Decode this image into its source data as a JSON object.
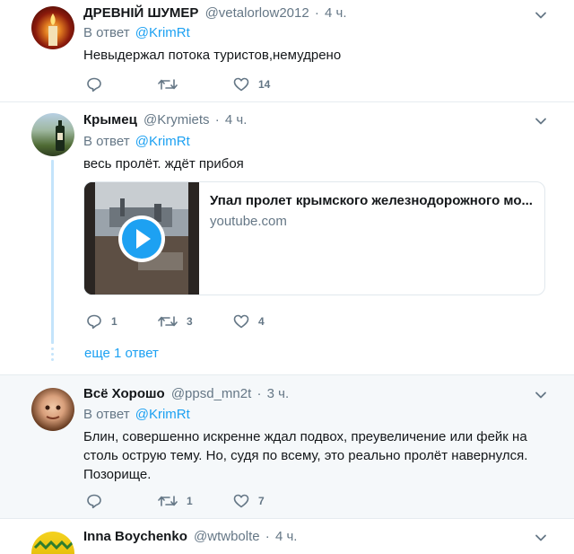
{
  "colors": {
    "accent": "#1da1f2",
    "muted": "#657786",
    "text": "#14171a",
    "border": "#e6ecf0",
    "highlight_bg": "#f5f8fa"
  },
  "tweets": [
    {
      "name": "ДРЕВНІЙ ШУМЕР",
      "handle": "@vetalorlow2012",
      "separator": "·",
      "time": "4 ч.",
      "reply_prefix": "В ответ",
      "reply_mention": "@KrimRt",
      "text": "Невыдержал потока туристов,немудрено",
      "reply_count": "",
      "retweet_count": "",
      "like_count": "14"
    },
    {
      "name": "Крымец",
      "handle": "@Krymiets",
      "separator": "·",
      "time": "4 ч.",
      "reply_prefix": "В ответ",
      "reply_mention": "@KrimRt",
      "text": "весь пролёт. ждёт прибоя",
      "card": {
        "title": "Упал пролет крымского железнодорожного мо...",
        "domain": "youtube.com"
      },
      "reply_count": "1",
      "retweet_count": "3",
      "like_count": "4",
      "more_replies": "еще 1 ответ"
    },
    {
      "name": "Всё Хорошо",
      "handle": "@ppsd_mn2t",
      "separator": "·",
      "time": "3 ч.",
      "reply_prefix": "В ответ",
      "reply_mention": "@KrimRt",
      "text": "Блин, совершенно искренне ждал подвох, преувеличение или фейк на столь острую тему. Но, судя по всему, это реально пролёт навернулся. Позорище.",
      "reply_count": "",
      "retweet_count": "1",
      "like_count": "7"
    },
    {
      "name": "Inna Boychenko",
      "handle": "@wtwbolte",
      "separator": "·",
      "time": "4 ч."
    }
  ],
  "icons": [
    "chevron-down-icon",
    "reply-icon",
    "retweet-icon",
    "like-icon",
    "play-icon"
  ]
}
